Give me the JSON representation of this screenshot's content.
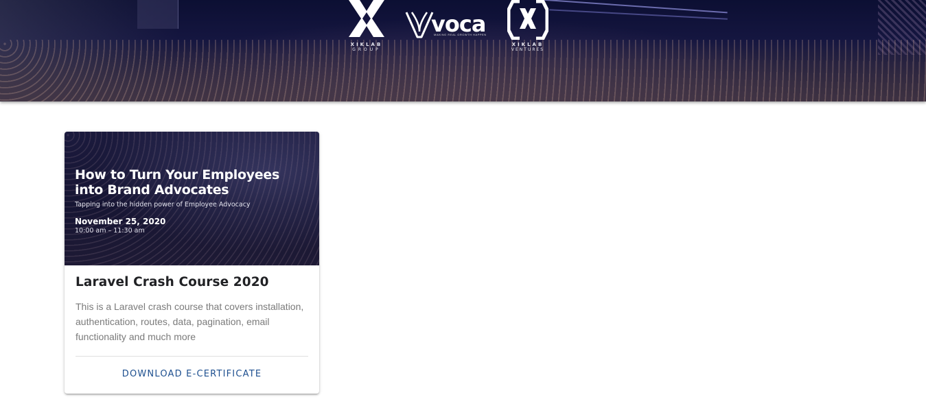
{
  "header": {
    "logos": [
      {
        "name": "XIKLAB",
        "sub": "GROUP"
      },
      {
        "name": "voca",
        "tagline": "MAKING REAL GROWTH HAPPEN"
      },
      {
        "name": "XIKLAB",
        "sub": "VENTURES"
      }
    ]
  },
  "card": {
    "media": {
      "title": "How to Turn Your Employees\ninto Brand Advocates",
      "subtitle": "Tapping into the hidden power of Employee Advocacy",
      "date": "November 25, 2020",
      "time": "10:00 am – 11:30 am"
    },
    "title": "Laravel Crash Course 2020",
    "description": "This is a Laravel crash course that covers installation, authentication, routes, data, pagination, email functionality and much more",
    "action_label": "DOWNLOAD E-CERTIFICATE"
  },
  "colors": {
    "accent": "#1d4f8f",
    "hero_bg": "#151640"
  }
}
